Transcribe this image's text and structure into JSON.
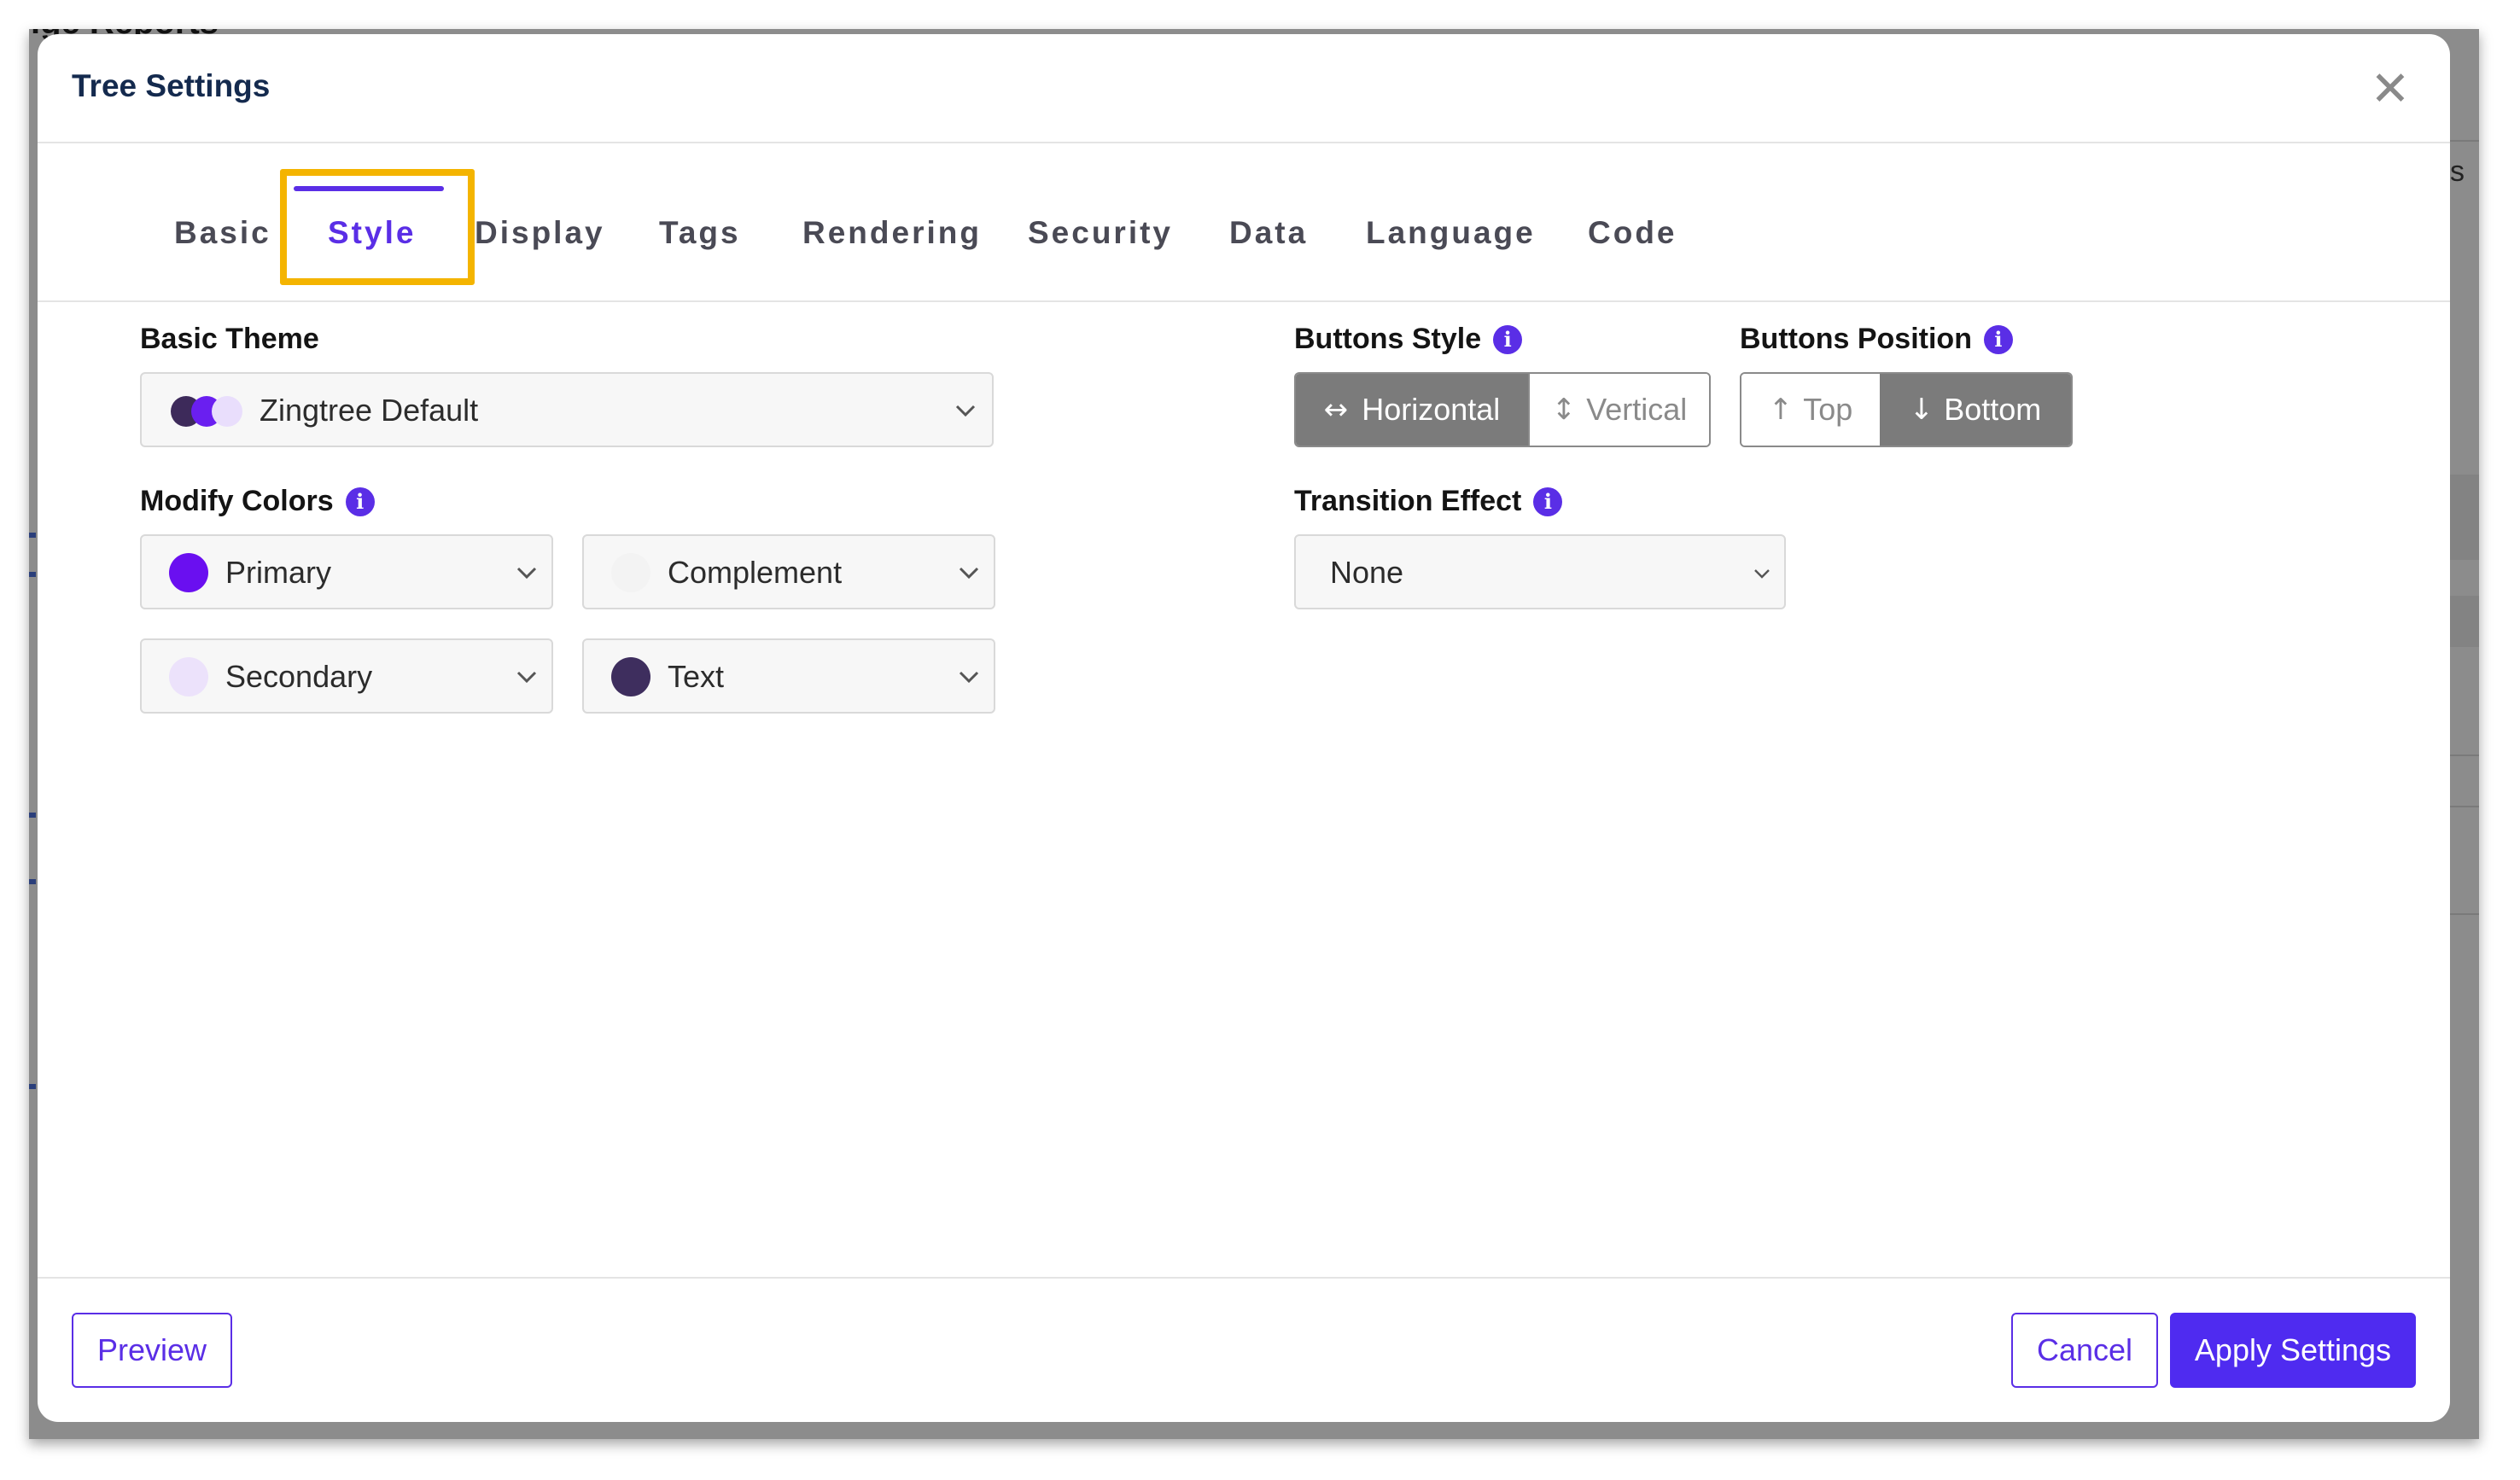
{
  "background": {
    "title_fragment": "ige Reports",
    "right_fragment": "s"
  },
  "modal": {
    "title": "Tree Settings",
    "close_glyph": "✕"
  },
  "tabs": [
    {
      "label": "Basic",
      "active": false
    },
    {
      "label": "Style",
      "active": true
    },
    {
      "label": "Display",
      "active": false
    },
    {
      "label": "Tags",
      "active": false
    },
    {
      "label": "Rendering",
      "active": false
    },
    {
      "label": "Security",
      "active": false
    },
    {
      "label": "Data",
      "active": false
    },
    {
      "label": "Language",
      "active": false
    },
    {
      "label": "Code",
      "active": false
    }
  ],
  "basic_theme": {
    "label": "Basic Theme",
    "value": "Zingtree Default",
    "swatch_colors": [
      "#3d2a5a",
      "#6a1ff0",
      "#e9defc"
    ]
  },
  "modify_colors": {
    "label": "Modify Colors",
    "items": [
      {
        "label": "Primary",
        "color": "#6a0ff0"
      },
      {
        "label": "Complement",
        "color": "#f3f3f3"
      },
      {
        "label": "Secondary",
        "color": "#ece2fb"
      },
      {
        "label": "Text",
        "color": "#3e2e5e"
      }
    ]
  },
  "buttons_style": {
    "label": "Buttons Style",
    "options": [
      {
        "icon": "↔",
        "label": "Horizontal",
        "selected": true
      },
      {
        "icon": "↕",
        "label": "Vertical",
        "selected": false
      }
    ]
  },
  "buttons_position": {
    "label": "Buttons Position",
    "options": [
      {
        "icon": "↑",
        "label": "Top",
        "selected": false
      },
      {
        "icon": "↓",
        "label": "Bottom",
        "selected": true
      }
    ]
  },
  "transition_effect": {
    "label": "Transition Effect",
    "value": "None"
  },
  "footer": {
    "preview_label": "Preview",
    "cancel_label": "Cancel",
    "apply_label": "Apply Settings"
  },
  "colors": {
    "accent": "#5a2ee6",
    "primary_button": "#4f2bf0",
    "highlight": "#f4b400",
    "title": "#142a4e"
  }
}
